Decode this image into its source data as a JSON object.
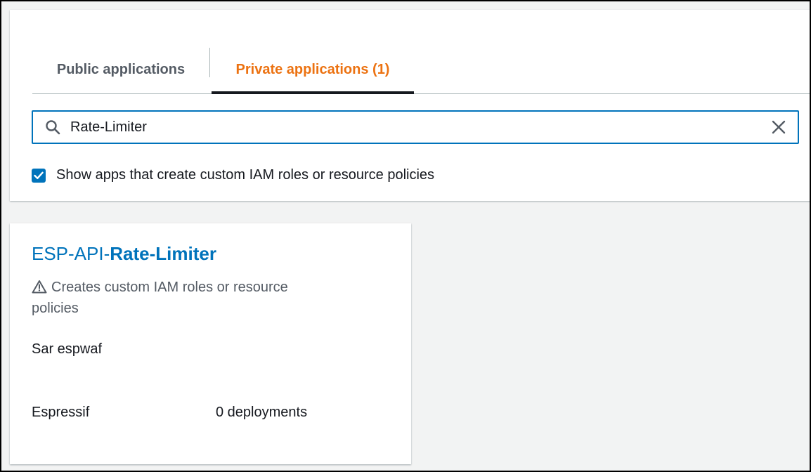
{
  "tabs": {
    "public_label": "Public applications",
    "private_label": "Private applications (1)"
  },
  "search": {
    "value": "Rate-Limiter",
    "icon": "search-icon",
    "clear_icon": "close-icon"
  },
  "filter": {
    "checked": true,
    "label": "Show apps that create custom IAM roles or resource policies"
  },
  "app_card": {
    "title_prefix": "ESP-API-",
    "title_match": "Rate-Limiter",
    "warning_icon": "warning-icon",
    "warning_text": "Creates custom IAM roles or resource policies",
    "description": "Sar espwaf",
    "author": "Espressif",
    "deployments": "0 deployments"
  },
  "colors": {
    "accent_blue": "#0073bb",
    "active_tab_orange": "#ec7211",
    "background": "#f2f3f3"
  }
}
